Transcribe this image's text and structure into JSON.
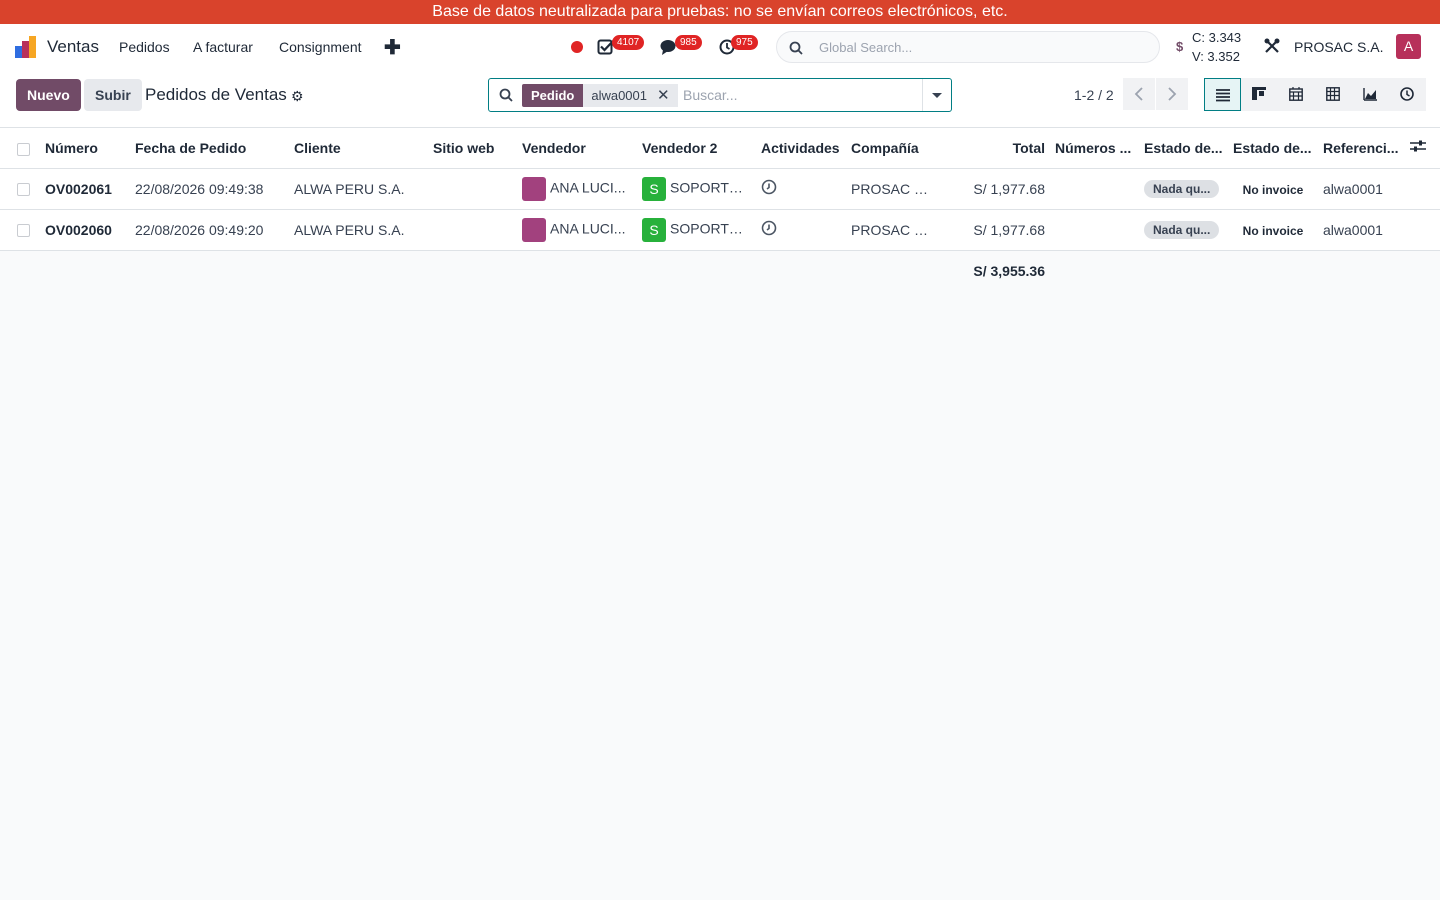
{
  "banner": "Base de datos neutralizada para pruebas: no se envían correos electrónicos, etc.",
  "nav": {
    "app_name": "Ventas",
    "menu": [
      "Pedidos",
      "A facturar",
      "Consignment"
    ],
    "badges": {
      "activities": "4107",
      "messages": "985",
      "timers": "975"
    },
    "global_search_placeholder": "Global Search...",
    "rate_c": "C: 3.343",
    "rate_v": "V: 3.352",
    "rate_symbol": "$",
    "company": "PROSAC S.A.",
    "avatar_letter": "A"
  },
  "control": {
    "new_label": "Nuevo",
    "upload_label": "Subir",
    "title": "Pedidos de Ventas",
    "facet_label": "Pedido",
    "facet_value": "alwa0001",
    "search_placeholder": "Buscar...",
    "pager": "1-2 / 2"
  },
  "columns": [
    "Número",
    "Fecha de Pedido",
    "Cliente",
    "Sitio web",
    "Vendedor",
    "Vendedor 2",
    "Actividades",
    "Compañía",
    "Total",
    "Números ...",
    "Estado de...",
    "Estado de...",
    "Referenci..."
  ],
  "rows": [
    {
      "numero": "OV002061",
      "fecha": "22/08/2026 09:49:38",
      "cliente": "ALWA PERU S.A.",
      "sitio": "",
      "vendedor": "ANA LUCI...",
      "vendedor2_initial": "S",
      "vendedor2": "SOPORTE ...",
      "compania": "PROSAC S...",
      "total": "S/ 1,977.68",
      "numeros": "",
      "estado1": "Nada qu...",
      "estado2": "No invoice",
      "referencia": "alwa0001"
    },
    {
      "numero": "OV002060",
      "fecha": "22/08/2026 09:49:20",
      "cliente": "ALWA PERU S.A.",
      "sitio": "",
      "vendedor": "ANA LUCI...",
      "vendedor2_initial": "S",
      "vendedor2": "SOPORTE ...",
      "compania": "PROSAC S...",
      "total": "S/ 1,977.68",
      "numeros": "",
      "estado1": "Nada qu...",
      "estado2": "No invoice",
      "referencia": "alwa0001"
    }
  ],
  "grand_total": "S/ 3,955.36",
  "colors": {
    "brand": "#714b67",
    "banner": "#d9432c",
    "accent": "#017e84",
    "chip_vendedor": "#a2417e",
    "chip_vendedor2": "#27b13b"
  }
}
